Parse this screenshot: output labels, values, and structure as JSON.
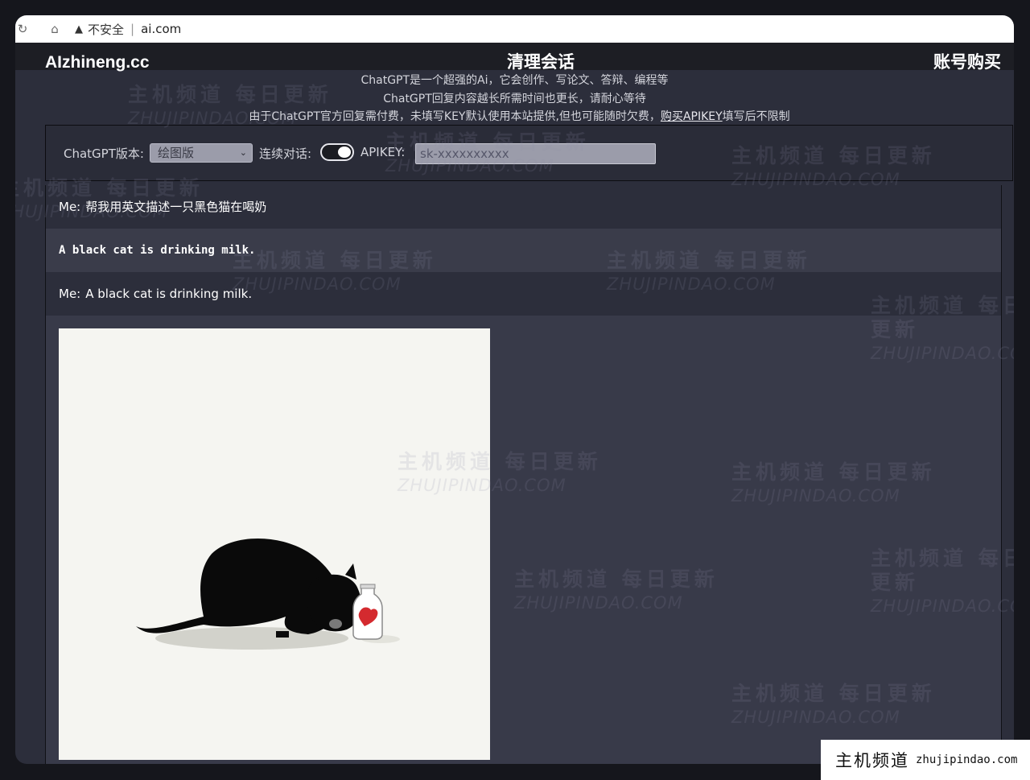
{
  "browser": {
    "reload_icon": "reload-icon",
    "home_icon": "home-icon",
    "warning_icon": "warning-icon",
    "security_label": "不安全",
    "separator": "|",
    "url": "ai.com"
  },
  "header": {
    "brand": "AIzhineng.cc",
    "clear_label": "清理会话",
    "buy_label": "账号购买"
  },
  "notice": {
    "line1": "ChatGPT是一个超强的Ai，它会创作、写论文、答辩、编程等",
    "line2": "ChatGPT回复内容越长所需时间也更长，请耐心等待",
    "line3_prefix": "由于ChatGPT官方回复需付费，未填写KEY默认使用本站提供,但也可能随时欠费，",
    "line3_link": "购买APIKEY",
    "line3_suffix": "填写后不限制"
  },
  "settings": {
    "version_label": "ChatGPT版本:",
    "version_selected": "绘图版",
    "continuous_label": "连续对话:",
    "continuous_on": true,
    "apikey_label": "APIKEY:",
    "apikey_placeholder": "sk-xxxxxxxxxx"
  },
  "messages": [
    {
      "role": "me",
      "prefix": "Me:",
      "text": "帮我用英文描述一只黑色猫在喝奶"
    },
    {
      "role": "bot",
      "text": "A black cat is drinking milk."
    },
    {
      "role": "me",
      "prefix": "Me:",
      "text": "A black cat is drinking milk."
    }
  ],
  "image_message": {
    "alt": "black-cat-drinking-milk-image"
  },
  "watermark": {
    "cn": "主机频道 每日更新",
    "en": "ZHUJIPINDAO.COM"
  },
  "badge": {
    "cn": "主机频道",
    "en": "zhujipindao.com"
  },
  "colors": {
    "page_bg": "#2c2e3b",
    "header_bg": "#1d1e24",
    "bot_row_bg": "#3a3c4a",
    "image_row_bg": "#383a49",
    "milk_heart": "#d42a2f"
  }
}
